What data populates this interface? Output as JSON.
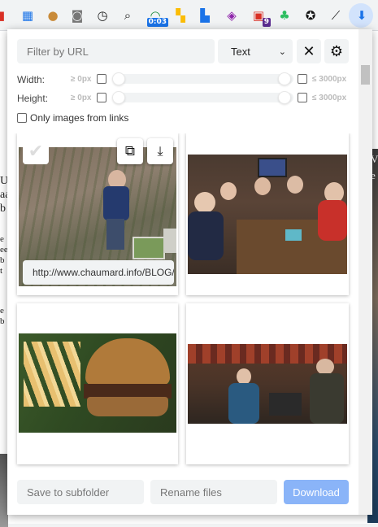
{
  "toolbar": {
    "icons": [
      {
        "name": "extension-red-icon",
        "glyph": "▮",
        "color": "#d93025"
      },
      {
        "name": "sheet-extension-icon",
        "glyph": "▦",
        "color": "#1a73e8"
      },
      {
        "name": "cookie-icon",
        "glyph": "●",
        "color": "#c98b3a"
      },
      {
        "name": "camera-icon",
        "glyph": "◙",
        "color": "#777777"
      },
      {
        "name": "clock-icon",
        "glyph": "◷",
        "color": "#222222"
      },
      {
        "name": "search-inspect-icon",
        "glyph": "⌕",
        "color": "#222222"
      },
      {
        "name": "speed-gauge-icon",
        "glyph": "◠",
        "color": "#1e8e3e"
      },
      {
        "name": "squares-extension-icon",
        "glyph": "▚",
        "color": "#fbbc04"
      },
      {
        "name": "stack-extension-icon",
        "glyph": "▙",
        "color": "#1a73e8"
      },
      {
        "name": "shield-extension-icon",
        "glyph": "◈",
        "color": "#8e24aa"
      },
      {
        "name": "monitor-extension-icon",
        "glyph": "▣",
        "color": "#d93025"
      },
      {
        "name": "evernote-icon",
        "glyph": "♣",
        "color": "#2dbe60"
      },
      {
        "name": "aperture-icon",
        "glyph": "✪",
        "color": "#111111"
      },
      {
        "name": "eyedropper-icon",
        "glyph": "⟋",
        "color": "#222222"
      },
      {
        "name": "image-downloader-icon",
        "glyph": "⬇",
        "color": "#1a73e8"
      }
    ],
    "badge_time": "0:03",
    "badge_count": "9"
  },
  "filter": {
    "url_placeholder": "Filter by URL",
    "mode_value": "Text"
  },
  "width_row": {
    "label": "Width:",
    "min_label": "≥ 0px",
    "max_label": "≤ 3000px"
  },
  "height_row": {
    "label": "Height:",
    "min_label": "≥ 0px",
    "max_label": "≤ 3000px"
  },
  "links_only_label": "Only images from links",
  "images": [
    {
      "url": "http://www.chaumard.info/BLOG/",
      "selected_hover": true
    },
    {
      "url": "",
      "selected_hover": false
    },
    {
      "url": "",
      "selected_hover": false
    },
    {
      "url": "",
      "selected_hover": false
    }
  ],
  "footer": {
    "subfolder_placeholder": "Save to subfolder",
    "rename_placeholder": "Rename files",
    "download_label": "Download"
  },
  "background_text": {
    "left_lines_1": [
      "Ui",
      "aa",
      "b"
    ],
    "left_lines_2": [
      "e",
      "ee",
      "b",
      "t"
    ],
    "left_lines_3": [
      "e",
      "b"
    ],
    "right_fragments": [
      "e",
      "V",
      "e"
    ]
  },
  "colors": {
    "accent": "#8ab4f8",
    "input_bg": "#f1f3f4"
  }
}
